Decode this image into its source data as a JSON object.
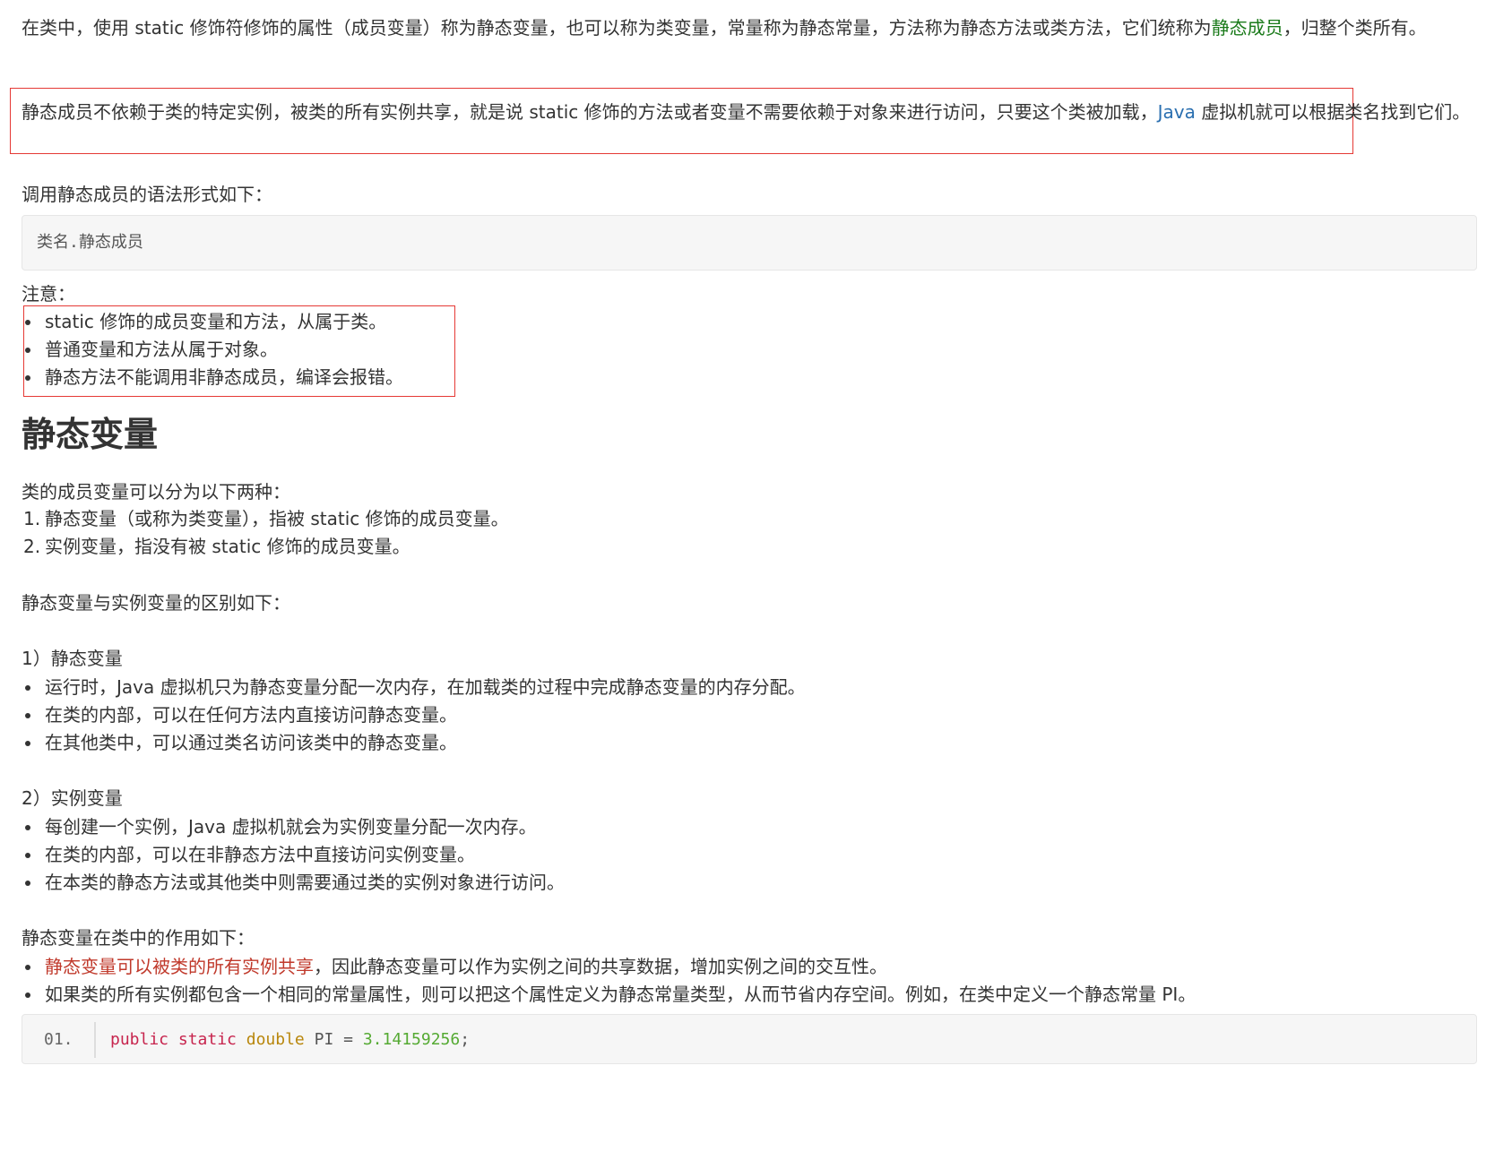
{
  "intro": {
    "part1": "在类中，使用 static 修饰符修饰的属性（成员变量）称为静态变量，也可以称为类变量，常量称为静态常量，方法称为静态方法或类方法，它们统称为",
    "link": "静态成员",
    "part2": "，归整个类所有。"
  },
  "highlight": {
    "part1": "静态成员不依赖于类的特定实例，被类的所有实例共享，就是说 static 修饰的方法或者变量不需要依赖于对象来进行访问，只要这个类被加载，",
    "link": "Java",
    "part2": " 虚拟机就可以根据类名找到它们。"
  },
  "syntax_label": "调用静态成员的语法形式如下：",
  "syntax_code": "类名.静态成员",
  "note_label": "注意：",
  "notes": [
    "static 修饰的成员变量和方法，从属于类。",
    "普通变量和方法从属于对象。",
    "静态方法不能调用非静态成员，编译会报错。"
  ],
  "heading": "静态变量",
  "member_intro": "类的成员变量可以分为以下两种：",
  "member_types": [
    {
      "num": "1.",
      "text": "静态变量（或称为类变量），指被 static 修饰的成员变量。"
    },
    {
      "num": "2.",
      "text": "实例变量，指没有被 static 修饰的成员变量。"
    }
  ],
  "diff_label": "静态变量与实例变量的区别如下：",
  "static_label": "1）静态变量",
  "static_items": [
    "运行时，Java 虚拟机只为静态变量分配一次内存，在加载类的过程中完成静态变量的内存分配。",
    "在类的内部，可以在任何方法内直接访问静态变量。",
    "在其他类中，可以通过类名访问该类中的静态变量。"
  ],
  "instance_label": "2）实例变量",
  "instance_items": [
    "每创建一个实例，Java 虚拟机就会为实例变量分配一次内存。",
    "在类的内部，可以在非静态方法中直接访问实例变量。",
    "在本类的静态方法或其他类中则需要通过类的实例对象进行访问。"
  ],
  "role_label": "静态变量在类中的作用如下：",
  "role_items": [
    {
      "highlight": "静态变量可以被类的所有实例共享",
      "text": "，因此静态变量可以作为实例之间的共享数据，增加实例之间的交互性。"
    },
    {
      "highlight": "",
      "text": "如果类的所有实例都包含一个相同的常量属性，则可以把这个属性定义为静态常量类型，从而节省内存空间。例如，在类中定义一个静态常量 PI。"
    }
  ],
  "code_line": {
    "line_no": "01.",
    "kw1": "public",
    "kw2": "static",
    "type": "double",
    "name": "PI",
    "op": "=",
    "value": "3.14159256",
    "end": ";"
  },
  "colors": {
    "link_green": "#1a7a1a",
    "link_blue": "#2a6fb0",
    "emphasis_red": "#c0392b",
    "box_border": "#e53935"
  }
}
